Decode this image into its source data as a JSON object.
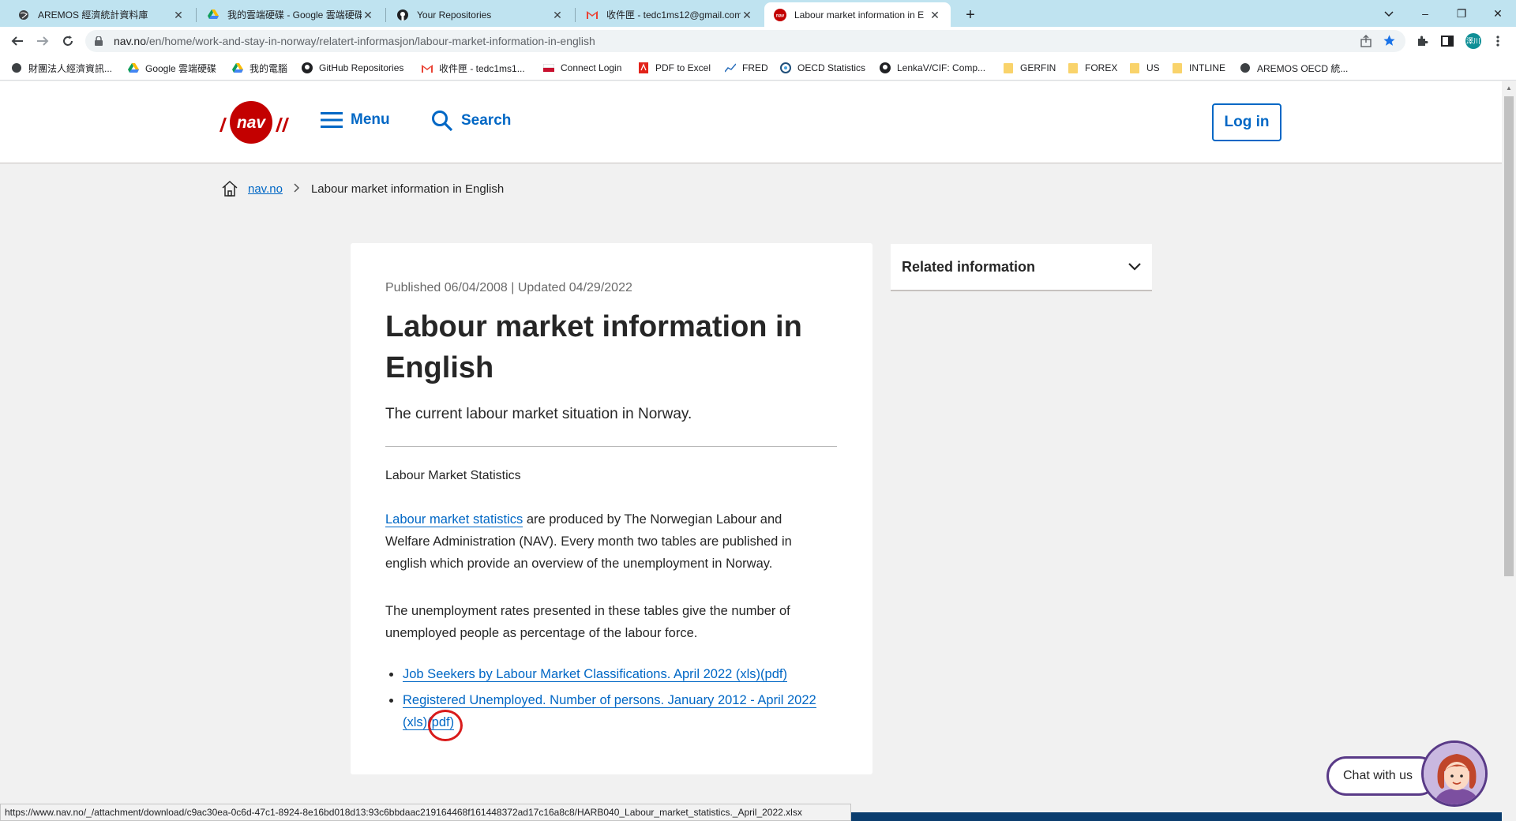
{
  "browser": {
    "tabs": [
      {
        "title": "AREMOS 經濟統計資料庫",
        "icon": "globe-icon"
      },
      {
        "title": "我的雲端硬碟 - Google 雲端硬碟",
        "icon": "google-drive-icon"
      },
      {
        "title": "Your Repositories",
        "icon": "github-icon"
      },
      {
        "title": "收件匣 - tedc1ms12@gmail.com",
        "icon": "gmail-icon"
      },
      {
        "title": "Labour market information in E",
        "icon": "nav-icon"
      }
    ],
    "url_host": "nav.no",
    "url_path": "/en/home/work-and-stay-in-norway/relatert-informasjon/labour-market-information-in-english",
    "profile_initials": "澤川",
    "bookmarks": [
      {
        "label": "財團法人經濟資訊...",
        "icon": "globe-icon"
      },
      {
        "label": "Google 雲端硬碟",
        "icon": "google-drive-icon"
      },
      {
        "label": "我的電腦",
        "icon": "google-drive-icon"
      },
      {
        "label": "GitHub Repositories",
        "icon": "github-icon"
      },
      {
        "label": "收件匣 - tedc1ms1...",
        "icon": "gmail-icon"
      },
      {
        "label": "Connect Login",
        "icon": "flag-icon"
      },
      {
        "label": "PDF to Excel",
        "icon": "pdf-icon"
      },
      {
        "label": "FRED",
        "icon": "chart-icon"
      },
      {
        "label": "OECD Statistics",
        "icon": "oecd-icon"
      },
      {
        "label": "LenkaV/CIF: Comp...",
        "icon": "github-icon"
      },
      {
        "label": "GERFIN",
        "icon": "folder-icon"
      },
      {
        "label": "FOREX",
        "icon": "folder-icon"
      },
      {
        "label": "US",
        "icon": "folder-icon"
      },
      {
        "label": "INTLINE",
        "icon": "folder-icon"
      },
      {
        "label": "AREMOS OECD 統...",
        "icon": "globe-icon"
      }
    ],
    "status_url": "https://www.nav.no/_/attachment/download/c9ac30ea-0c6d-47c1-8924-8e16bd018d13:93c6bbdaac219164468f161448372ad17c16a8c8/HARB040_Labour_market_statistics._April_2022.xlsx"
  },
  "header": {
    "menu_label": "Menu",
    "search_label": "Search",
    "login_label": "Log in",
    "brand_color": "#c30000",
    "accent_color": "#0067c5"
  },
  "breadcrumb": {
    "home_link": "nav.no",
    "current": "Labour market information in English"
  },
  "article": {
    "published": "Published 06/04/2008 | Updated 04/29/2022",
    "title": "Labour market information in English",
    "ingress": "The current labour market situation in Norway.",
    "section_heading": "Labour Market Statistics",
    "para1_link": "Labour market statistics",
    "para1_rest": " are produced by The Norwegian Labour and Welfare Administration (NAV). Every month two tables are published in english which provide an overview of the unemployment in Norway.",
    "para2": "The unemployment rates presented in these tables give the number of unemployed people as percentage of the labour force.",
    "links": [
      {
        "text": "Job Seekers by Labour Market Classifications. April 2022 (xls)(pdf)"
      },
      {
        "text_a": "Registered Unemployed. Number of persons. January 2012 - April 2022 ",
        "text_xls": "(xls)",
        "text_pdf": "(pdf)"
      }
    ]
  },
  "related": {
    "label": "Related information"
  },
  "chat": {
    "label": "Chat with us"
  }
}
